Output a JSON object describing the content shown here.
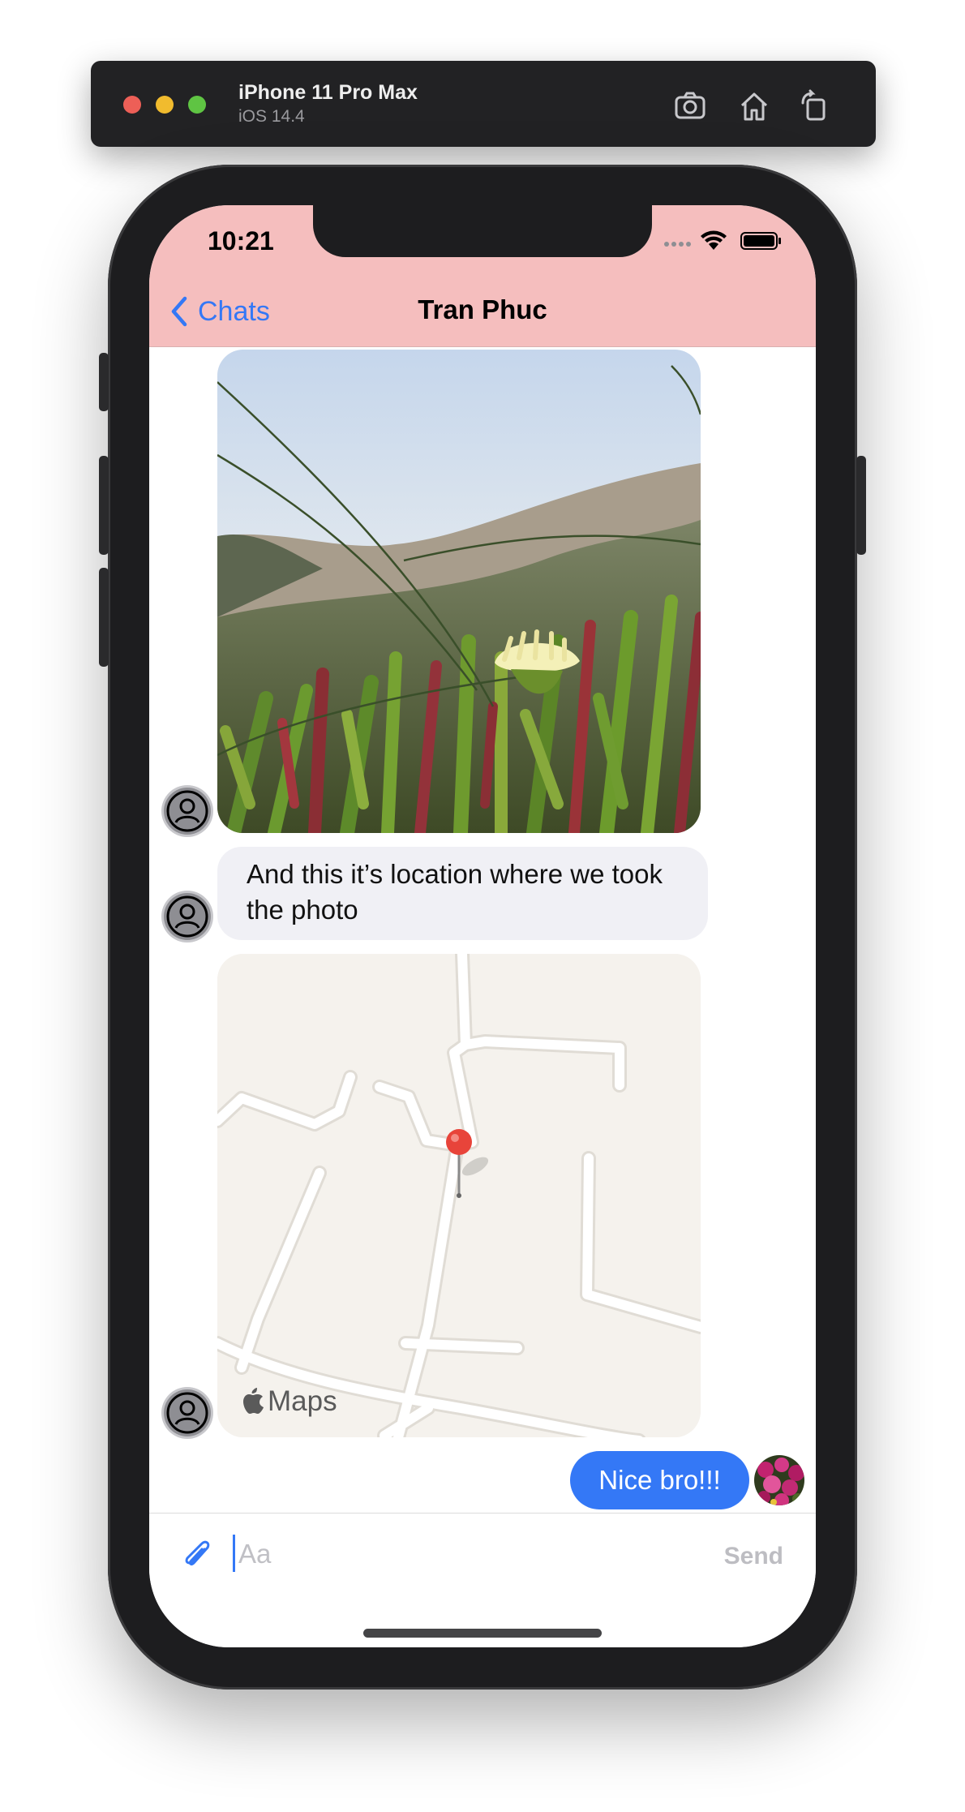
{
  "simulator": {
    "device_name": "iPhone 11 Pro Max",
    "os_version": "iOS 14.4",
    "buttons": [
      "screenshot-icon",
      "home-icon",
      "rotate-icon"
    ]
  },
  "status_bar": {
    "time": "10:21",
    "icons": [
      "signal-dots-icon",
      "wifi-icon",
      "battery-icon"
    ]
  },
  "nav": {
    "back_label": "Chats",
    "title": "Tran Phuc"
  },
  "messages": {
    "received_photo": {
      "type": "image",
      "description_icon": "flower-photo"
    },
    "received_text": "And this it’s location where we took the photo",
    "received_map": {
      "type": "location",
      "maps_label": "Maps"
    },
    "sent_text": "Nice bro!!!"
  },
  "composer": {
    "placeholder": "Aa",
    "send_label": "Send",
    "attach_icon": "paperclip-icon"
  },
  "colors": {
    "nav_background": "#f5bebe",
    "accent": "#3478f6",
    "received_bubble": "#f0f0f5",
    "device_frame": "#1d1d1f"
  }
}
